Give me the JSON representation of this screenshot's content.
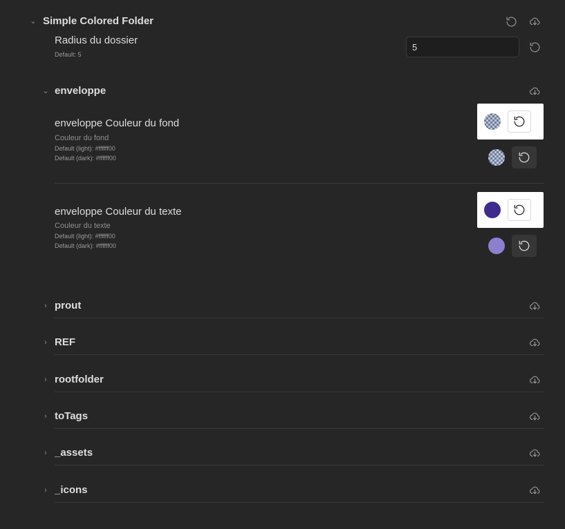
{
  "plugin": {
    "title": "Simple Colored Folder"
  },
  "radius": {
    "name": "Radius du dossier",
    "default_text": "Default: 5",
    "value": "5"
  },
  "enveloppe": {
    "title": "enveloppe",
    "background": {
      "name": "enveloppe Couleur du fond",
      "desc": "Couleur du fond",
      "default_light": "Default (light): #ffffff00",
      "default_dark": "Default (dark): #ffffff00",
      "light_color": "transparent",
      "dark_color": "transparent"
    },
    "text": {
      "name": "enveloppe Couleur du texte",
      "desc": "Couleur du texte",
      "default_light": "Default (light): #ffffff00",
      "default_dark": "Default (dark): #ffffff00",
      "light_color": "#3f2a8e",
      "dark_color": "#8c7fd0"
    }
  },
  "folders": [
    {
      "title": "prout"
    },
    {
      "title": "REF"
    },
    {
      "title": "rootfolder"
    },
    {
      "title": "toTags"
    },
    {
      "title": "_assets"
    },
    {
      "title": "_icons"
    }
  ],
  "icons": {
    "reset": "rotate-ccw-icon",
    "export": "cloud-download-icon",
    "chevron_open": "chevron-down-icon",
    "chevron_closed": "chevron-right-icon"
  }
}
